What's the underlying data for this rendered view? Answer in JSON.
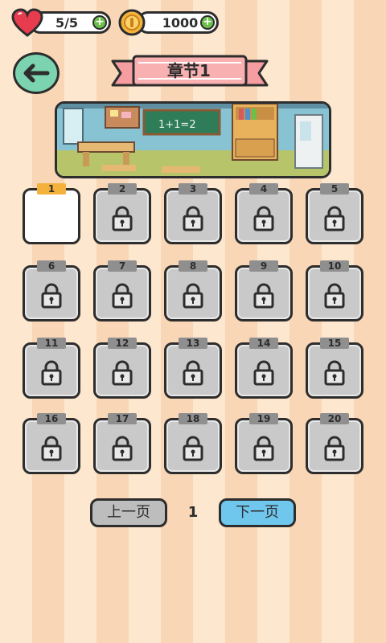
{
  "hud": {
    "lives": "5/5",
    "coins": "1000",
    "plus_symbol": "+"
  },
  "chapter": {
    "title": "章节1"
  },
  "levels": [
    {
      "num": "1",
      "locked": false
    },
    {
      "num": "2",
      "locked": true
    },
    {
      "num": "3",
      "locked": true
    },
    {
      "num": "4",
      "locked": true
    },
    {
      "num": "5",
      "locked": true
    },
    {
      "num": "6",
      "locked": true
    },
    {
      "num": "7",
      "locked": true
    },
    {
      "num": "8",
      "locked": true
    },
    {
      "num": "9",
      "locked": true
    },
    {
      "num": "10",
      "locked": true
    },
    {
      "num": "11",
      "locked": true
    },
    {
      "num": "12",
      "locked": true
    },
    {
      "num": "13",
      "locked": true
    },
    {
      "num": "14",
      "locked": true
    },
    {
      "num": "15",
      "locked": true
    },
    {
      "num": "16",
      "locked": true
    },
    {
      "num": "17",
      "locked": true
    },
    {
      "num": "18",
      "locked": true
    },
    {
      "num": "19",
      "locked": true
    },
    {
      "num": "20",
      "locked": true
    }
  ],
  "pager": {
    "prev_label": "上一页",
    "page": "1",
    "next_label": "下一页"
  },
  "banner": {
    "board_text": "1+1=2"
  },
  "colors": {
    "open_tag": "#f4b13c",
    "locked_tag": "#8f8f8f",
    "back_button": "#7bd3b0",
    "next_button": "#6fc7ee",
    "ribbon": "#f59da0"
  }
}
